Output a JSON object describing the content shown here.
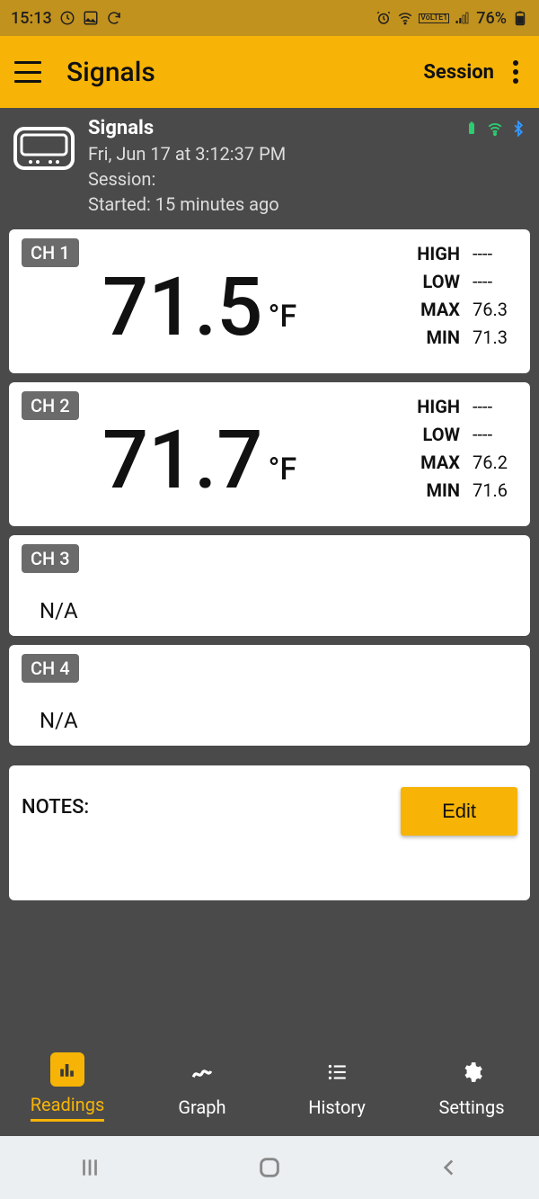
{
  "status": {
    "time": "15:13",
    "battery_percent": "76%"
  },
  "appbar": {
    "title": "Signals",
    "session_label": "Session"
  },
  "header": {
    "title": "Signals",
    "datetime": "Fri, Jun 17  at 3:12:37 PM",
    "session_label": "Session:",
    "started": "Started: 15 minutes ago"
  },
  "channels": [
    {
      "badge": "CH 1",
      "value": "71.5",
      "unit": "°F",
      "stats": {
        "high_label": "HIGH",
        "high": "----",
        "low_label": "LOW",
        "low": "----",
        "max_label": "MAX",
        "max": "76.3",
        "min_label": "MIN",
        "min": "71.3"
      }
    },
    {
      "badge": "CH 2",
      "value": "71.7",
      "unit": "°F",
      "stats": {
        "high_label": "HIGH",
        "high": "----",
        "low_label": "LOW",
        "low": "----",
        "max_label": "MAX",
        "max": "76.2",
        "min_label": "MIN",
        "min": "71.6"
      }
    },
    {
      "badge": "CH 3",
      "na": "N/A"
    },
    {
      "badge": "CH 4",
      "na": "N/A"
    }
  ],
  "notes": {
    "label": "NOTES:",
    "edit_label": "Edit"
  },
  "nav": {
    "readings": "Readings",
    "graph": "Graph",
    "history": "History",
    "settings": "Settings"
  }
}
